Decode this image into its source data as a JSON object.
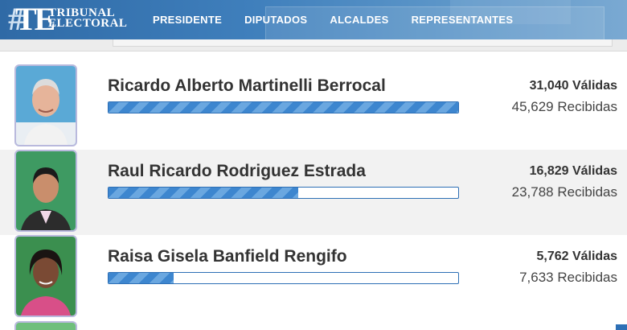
{
  "header": {
    "logo_mark": "TE",
    "logo_line1": "TRIBUNAL",
    "logo_line2": "ELECTORAL",
    "nav": [
      "PRESIDENTE",
      "DIPUTADOS",
      "ALCALDES",
      "REPRESENTANTES"
    ]
  },
  "candidates": [
    {
      "name": "Ricardo Alberto Martinelli Berrocal",
      "valid": "31,040 Válidas",
      "received": "45,629 Recibidas",
      "progress": 1.0,
      "photo_bg": "#5aa9d6"
    },
    {
      "name": "Raul Ricardo Rodriguez Estrada",
      "valid": "16,829 Válidas",
      "received": "23,788 Recibidas",
      "progress": 0.542,
      "photo_bg": "#3e9a62"
    },
    {
      "name": "Raisa Gisela Banfield Rengifo",
      "valid": "5,762 Válidas",
      "received": "7,633 Recibidas",
      "progress": 0.186,
      "photo_bg": "#3b8f4f"
    }
  ],
  "colors": {
    "bar_border": "#2d6fb5",
    "bar_fill": "#3d86cf",
    "header": "#3f7fbc"
  }
}
